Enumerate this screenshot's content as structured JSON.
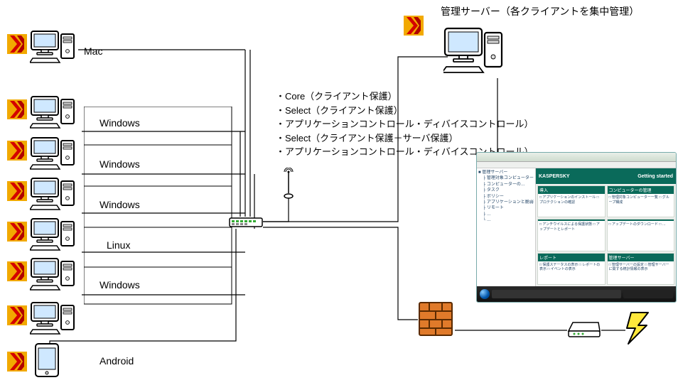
{
  "title": "管理サーバー（各クライアントを集中管理）",
  "clients": [
    {
      "os": "Mac"
    },
    {
      "os": "Windows"
    },
    {
      "os": "Windows"
    },
    {
      "os": "Windows"
    },
    {
      "os": "Linux"
    },
    {
      "os": "Windows"
    },
    {
      "os": "Android"
    }
  ],
  "features": [
    "・Core（クライアント保護）",
    "・Select（クライアント保護）",
    "・アプリケーションコントロール・ディバイスコントロール）",
    "・Select（クライアント保護＋サーバ保護）",
    "・アプリケーションコントロール・ディバイスコントロール）"
  ],
  "mgmt_console": {
    "brand": "KASPERSKY",
    "heading": "Getting started",
    "tree": [
      "■ 管理サーバー",
      "　├ 管理対象コンピューター",
      "　├ コンピューターの…",
      "　├ タスク",
      "　├ ポリシー",
      "　├ アプリケーションと脆弱性",
      "　├ リモート",
      "　├ …",
      "　└ …"
    ],
    "panels": [
      {
        "h": "導入",
        "b": "□ アプリケーションのインストール\n□ プロテクションの確認"
      },
      {
        "h": "コンピューターの管理",
        "b": "□ 管理対象コンピューター一覧\n□ グループ構成"
      },
      {
        "h": "",
        "b": "□ アンチウイルスによる保護状態\n□ アップデートとレポート"
      },
      {
        "h": "",
        "b": "□ アップデートのダウンロード\n□ …"
      },
      {
        "h": "レポート",
        "b": "□ 保護ステータスの表示\n□ レポートの表示\n□ イベントの表示"
      },
      {
        "h": "管理サーバー",
        "b": "□ 管理サーバーの設定\n□ 管理サーバーに関する統計情報の表示"
      }
    ]
  },
  "icon_labels": {
    "badge": "kaspersky-badge-icon",
    "pc": "client-computer-icon",
    "tablet": "tablet-icon",
    "switch": "network-switch-icon",
    "antenna": "wireless-antenna-icon",
    "server": "management-server-icon",
    "firewall": "firewall-icon",
    "modem": "modem-icon",
    "bolt": "lightning-icon"
  }
}
